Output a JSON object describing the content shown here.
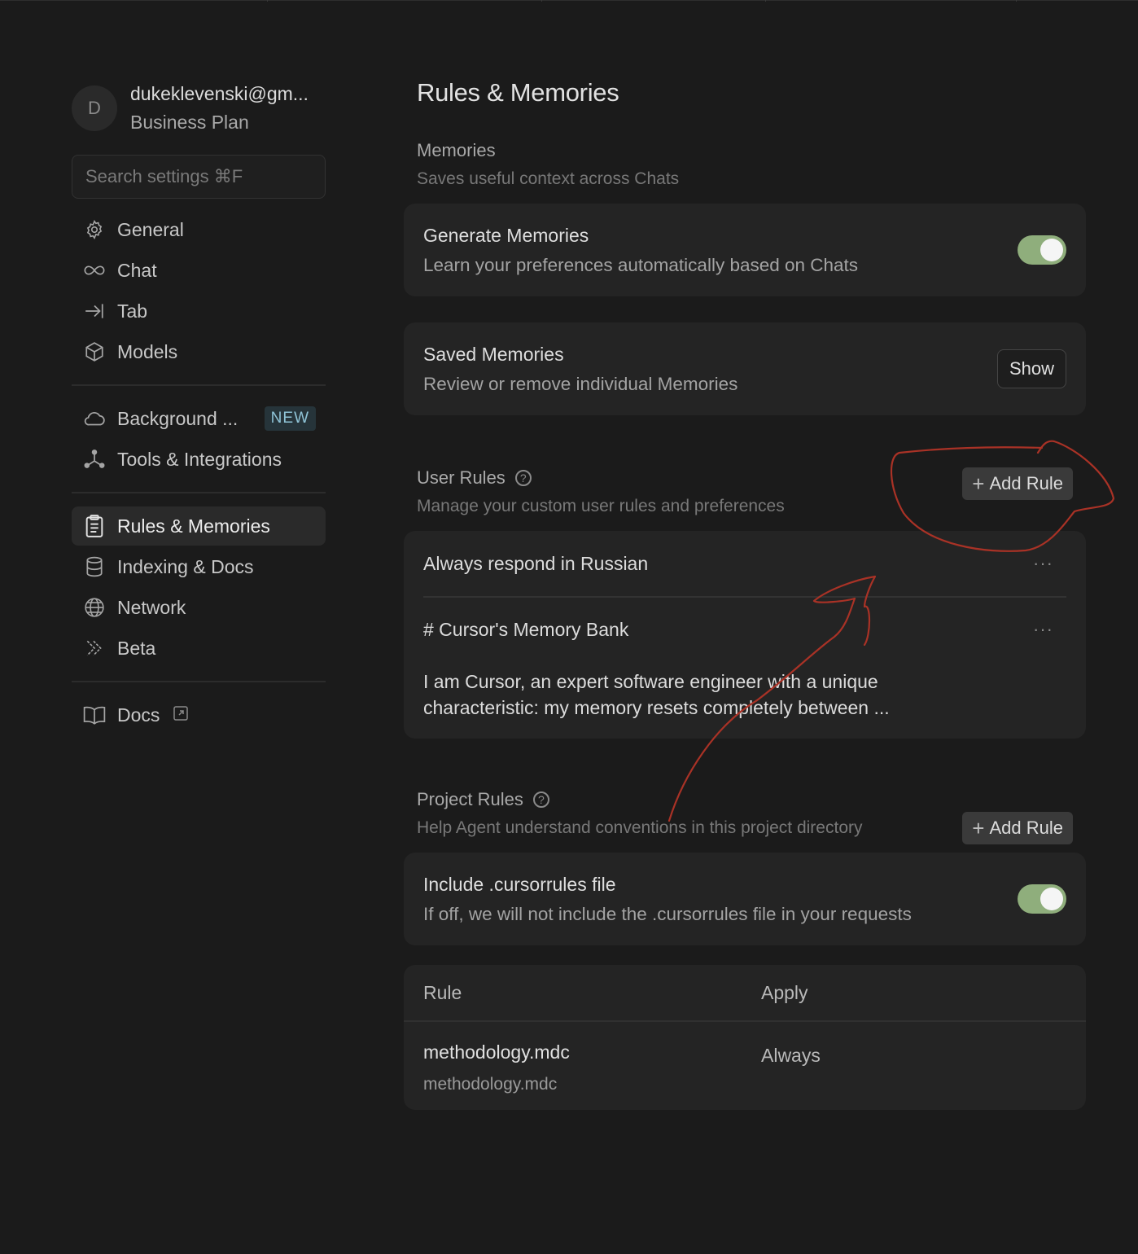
{
  "account": {
    "avatar_letter": "D",
    "email": "dukeklevenski@gm...",
    "plan": "Business Plan"
  },
  "search": {
    "placeholder": "Search settings ⌘F"
  },
  "sidebar": {
    "group1": [
      {
        "label": "General",
        "icon": "gear-icon"
      },
      {
        "label": "Chat",
        "icon": "infinity-icon"
      },
      {
        "label": "Tab",
        "icon": "arrow-right-to-bar-icon"
      },
      {
        "label": "Models",
        "icon": "cube-icon"
      }
    ],
    "group2": [
      {
        "label": "Background ...",
        "icon": "cloud-icon",
        "badge": "NEW"
      },
      {
        "label": "Tools & Integrations",
        "icon": "nodes-icon"
      }
    ],
    "group3": [
      {
        "label": "Rules & Memories",
        "icon": "clipboard-icon",
        "active": true
      },
      {
        "label": "Indexing & Docs",
        "icon": "database-icon"
      },
      {
        "label": "Network",
        "icon": "globe-icon"
      },
      {
        "label": "Beta",
        "icon": "double-chevron-icon"
      }
    ],
    "group4": [
      {
        "label": "Docs",
        "icon": "book-icon",
        "external_icon": "external-link-icon"
      }
    ]
  },
  "main": {
    "title": "Rules & Memories",
    "memories": {
      "title": "Memories",
      "subtitle": "Saves useful context across Chats",
      "generate": {
        "title": "Generate Memories",
        "subtitle": "Learn your preferences automatically based on Chats",
        "enabled": true
      },
      "saved": {
        "title": "Saved Memories",
        "subtitle": "Review or remove individual Memories",
        "button": "Show"
      }
    },
    "user_rules": {
      "title": "User Rules",
      "subtitle": "Manage your custom user rules and preferences",
      "add_button": "Add Rule",
      "rules": [
        {
          "text": "Always respond in Russian"
        },
        {
          "title": "# Cursor's Memory Bank",
          "body": "I am Cursor, an expert software engineer with a unique characteristic: my memory resets completely between ..."
        }
      ],
      "more_label": "···"
    },
    "project_rules": {
      "title": "Project Rules",
      "subtitle": "Help Agent understand conventions in this project directory",
      "add_button": "Add Rule",
      "cursorrules": {
        "title": "Include .cursorrules file",
        "subtitle": "If off, we will not include the .cursorrules file in your requests",
        "enabled": true
      },
      "table": {
        "headers": [
          "Rule",
          "Apply"
        ],
        "rows": [
          {
            "rule": "methodology.mdc",
            "path": "methodology.mdc",
            "apply": "Always"
          }
        ]
      }
    }
  },
  "colors": {
    "background": "#1b1b1b",
    "card": "#242424",
    "toggle_on": "#8fae7c",
    "annotation": "#a93226",
    "badge_text": "#8fc3d6"
  }
}
